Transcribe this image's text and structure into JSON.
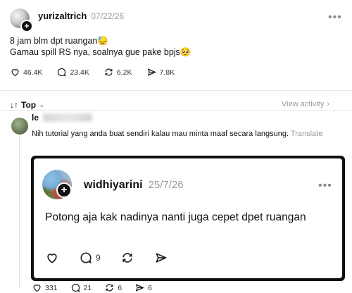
{
  "post": {
    "username": "yurizaltrich",
    "date": "07/22/26",
    "line1": "8 jam blm dpt ruangan😓",
    "line2": "Gamau spill RS nya, soalnya gue pake bpjs🥺",
    "likes": "46.4K",
    "comments": "23.4K",
    "reposts": "6.2K",
    "shares": "7.8K"
  },
  "sort": {
    "label": "Top",
    "view_activity": "View activity"
  },
  "reply": {
    "username_visible": "le",
    "text": "Nih tutorial yang anda buat sendiri kalau mau minta maaf secara langsung.",
    "translate": "Translate",
    "likes": "331",
    "comments": "21",
    "reposts": "6",
    "shares": "6"
  },
  "quoted": {
    "username": "widhiyarini",
    "date": "25/7/26",
    "text": "Potong aja kak nadinya nanti juga cepet dpet ruangan",
    "comments": "9"
  }
}
